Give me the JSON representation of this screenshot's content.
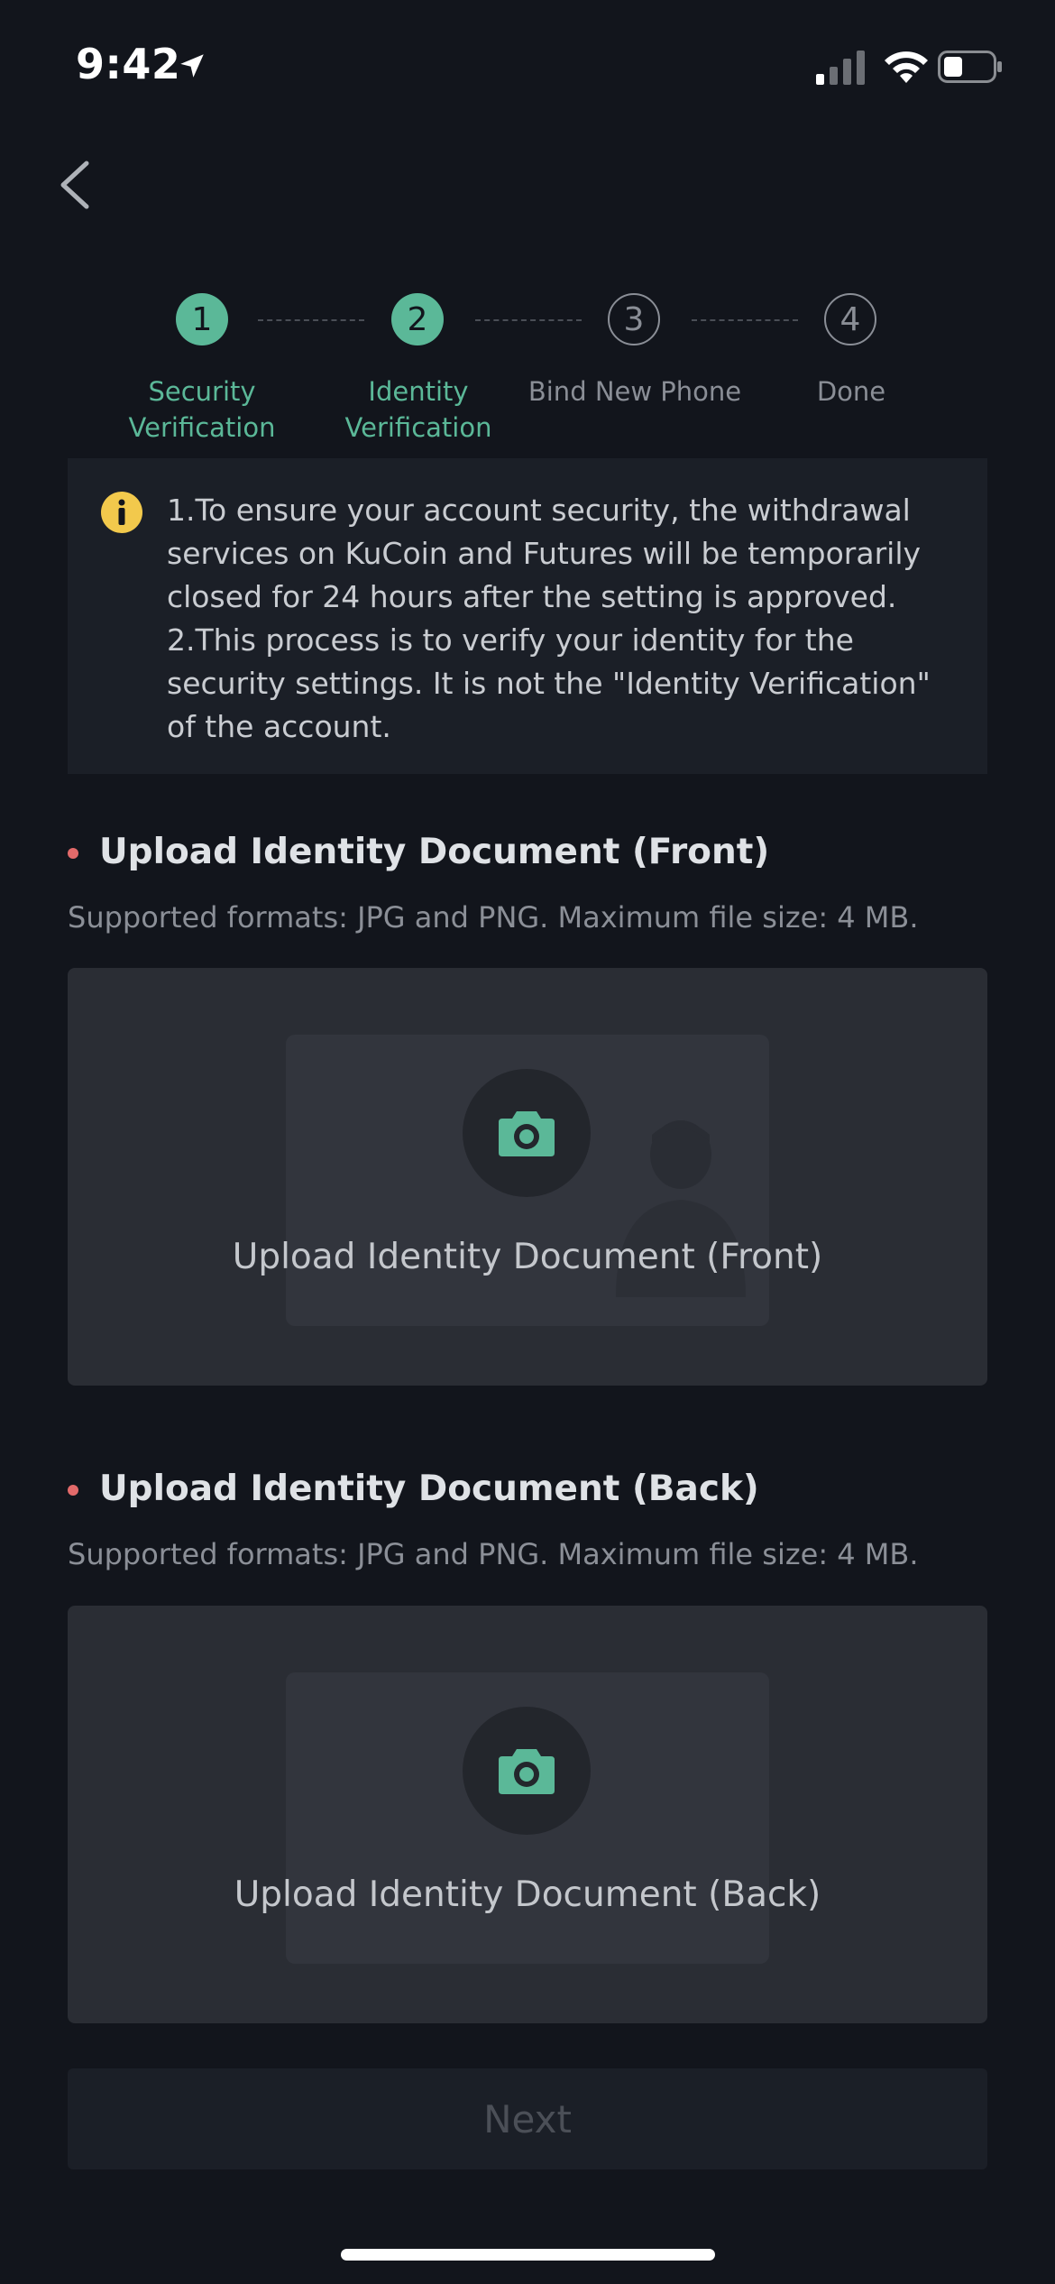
{
  "status_bar": {
    "time": "9:42"
  },
  "stepper": {
    "steps": [
      {
        "number": "1",
        "label_line1": "Security",
        "label_line2": "Verification",
        "state": "done"
      },
      {
        "number": "2",
        "label_line1": "Identity",
        "label_line2": "Verification",
        "state": "done"
      },
      {
        "number": "3",
        "label_line1": "Bind New Phone",
        "label_line2": "",
        "state": "todo"
      },
      {
        "number": "4",
        "label_line1": "Done",
        "label_line2": "",
        "state": "todo"
      }
    ]
  },
  "notice": {
    "line1": "1.To ensure your account security, the withdrawal services on KuCoin and Futures will be temporarily closed for 24 hours after the setting is approved.",
    "line2": "2.This process is to verify your identity for the security settings. It is not the \"Identity Verification\" of the account."
  },
  "front": {
    "title": "Upload Identity Document (Front)",
    "hint": "Supported formats: JPG and PNG. Maximum file size: 4 MB.",
    "upload_label": "Upload Identity Document (Front)"
  },
  "back": {
    "title": "Upload Identity Document (Back)",
    "hint": "Supported formats: JPG and PNG. Maximum file size: 4 MB.",
    "upload_label": "Upload Identity Document (Back)"
  },
  "next_label": "Next",
  "colors": {
    "accent": "#5bb898",
    "background": "#12151c",
    "required": "#e36a6a",
    "warning": "#f2c94c"
  }
}
